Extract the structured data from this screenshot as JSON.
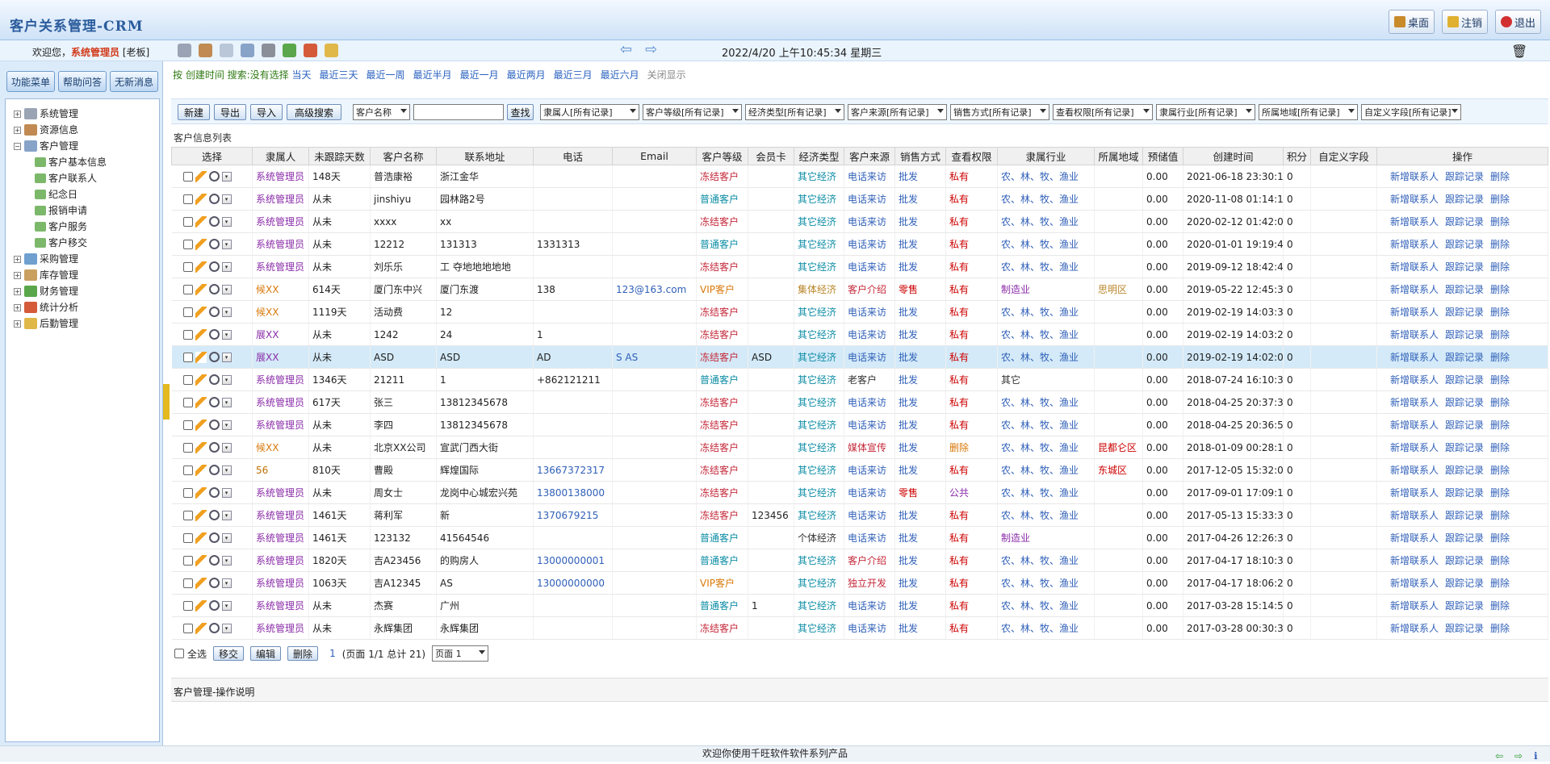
{
  "app": {
    "title": "客户关系管理-CRM"
  },
  "topbar": {
    "desktop": "桌面",
    "logout": "注销",
    "exit": "退出"
  },
  "welcome": {
    "prefix": "欢迎您，",
    "user": "系统管理员",
    "suffix": "[老板]",
    "datetime": "2022/4/20 上午10:45:34 星期三"
  },
  "sidebar": {
    "buttons": [
      "功能菜单",
      "帮助问答",
      "无新消息"
    ],
    "tree": [
      {
        "label": "系统管理",
        "expanded": false
      },
      {
        "label": "资源信息",
        "expanded": false
      },
      {
        "label": "客户管理",
        "expanded": true,
        "children": [
          "客户基本信息",
          "客户联系人",
          "纪念日",
          "报销申请",
          "客户服务",
          "客户移交"
        ]
      },
      {
        "label": "采购管理",
        "expanded": false
      },
      {
        "label": "库存管理",
        "expanded": false
      },
      {
        "label": "财务管理",
        "expanded": false
      },
      {
        "label": "统计分析",
        "expanded": false
      },
      {
        "label": "后勤管理",
        "expanded": false
      }
    ]
  },
  "filter": {
    "lead": "按 创建时间 搜索:没有选择",
    "links": [
      "当天",
      "最近三天",
      "最近一周",
      "最近半月",
      "最近一月",
      "最近两月",
      "最近三月",
      "最近六月"
    ],
    "close": "关闭显示"
  },
  "actions": {
    "new": "新建",
    "export": "导出",
    "import": "导入",
    "advanced": "高级搜索",
    "search": "查找",
    "field_select": "客户名称",
    "filters": [
      "隶属人[所有记录]",
      "客户等级[所有记录]",
      "经济类型[所有记录]",
      "客户来源[所有记录]",
      "销售方式[所有记录]",
      "查看权限[所有记录]",
      "隶属行业[所有记录]",
      "所属地域[所有记录]",
      "自定义字段[所有记录]"
    ]
  },
  "list": {
    "title": "客户信息列表",
    "columns": [
      "选择",
      "隶属人",
      "未跟踪天数",
      "客户名称",
      "联系地址",
      "电话",
      "Email",
      "客户等级",
      "会员卡",
      "经济类型",
      "客户来源",
      "销售方式",
      "查看权限",
      "隶属行业",
      "所属地域",
      "预储值",
      "创建时间",
      "积分",
      "自定义字段",
      "操作"
    ],
    "row_actions": [
      "新增联系人",
      "跟踪记录",
      "删除"
    ],
    "rows": [
      {
        "owner": "系统管理员",
        "ownerColor": "purple",
        "days": "148天",
        "name": "普浩康裕",
        "addr": "浙江金华",
        "phone": "",
        "email": "",
        "level": "冻结客户",
        "card": "",
        "econ": "其它经济",
        "source": "电话来访",
        "sale": "批发",
        "perm": "私有",
        "ind": "农、林、牧、渔业",
        "region": "",
        "pre": "0.00",
        "created": "2021-06-18 23:30:13",
        "pts": "0",
        "custom": ""
      },
      {
        "owner": "系统管理员",
        "ownerColor": "purple",
        "days": "从未",
        "name": "jinshiyu",
        "addr": "园林路2号",
        "phone": "",
        "email": "",
        "level": "普通客户",
        "card": "",
        "econ": "其它经济",
        "source": "电话来访",
        "sale": "批发",
        "perm": "私有",
        "ind": "农、林、牧、渔业",
        "region": "",
        "pre": "0.00",
        "created": "2020-11-08 01:14:11",
        "pts": "0",
        "custom": ""
      },
      {
        "owner": "系统管理员",
        "ownerColor": "purple",
        "days": "从未",
        "name": "xxxx",
        "addr": "xx",
        "phone": "",
        "email": "",
        "level": "冻结客户",
        "card": "",
        "econ": "其它经济",
        "source": "电话来访",
        "sale": "批发",
        "perm": "私有",
        "ind": "农、林、牧、渔业",
        "region": "",
        "pre": "0.00",
        "created": "2020-02-12 01:42:06",
        "pts": "0",
        "custom": ""
      },
      {
        "owner": "系统管理员",
        "ownerColor": "purple",
        "days": "从未",
        "name": "12212",
        "addr": "131313",
        "phone": "1331313",
        "email": "",
        "level": "普通客户",
        "card": "",
        "econ": "其它经济",
        "source": "电话来访",
        "sale": "批发",
        "perm": "私有",
        "ind": "农、林、牧、渔业",
        "region": "",
        "pre": "0.00",
        "created": "2020-01-01 19:19:40",
        "pts": "0",
        "custom": ""
      },
      {
        "owner": "系统管理员",
        "ownerColor": "purple",
        "days": "从未",
        "name": "刘乐乐",
        "addr": "工 夺地地地地地",
        "phone": "",
        "email": "",
        "level": "冻结客户",
        "card": "",
        "econ": "其它经济",
        "source": "电话来访",
        "sale": "批发",
        "perm": "私有",
        "ind": "农、林、牧、渔业",
        "region": "",
        "pre": "0.00",
        "created": "2019-09-12 18:42:44",
        "pts": "0",
        "custom": ""
      },
      {
        "owner": "候XX",
        "ownerColor": "orange",
        "days": "614天",
        "name": "厦门东中兴",
        "addr": "厦门东渡",
        "phone": "138",
        "email": "123@163.com",
        "level": "VIP客户",
        "card": "",
        "econ": "集体经济",
        "source": "客户介绍",
        "sale": "零售",
        "perm": "私有",
        "ind": "制造业",
        "region": "思明区",
        "pre": "0.00",
        "created": "2019-05-22 12:45:33",
        "pts": "0",
        "custom": ""
      },
      {
        "owner": "候XX",
        "ownerColor": "orange",
        "days": "1119天",
        "name": "活动费",
        "addr": "12",
        "phone": "",
        "email": "",
        "level": "冻结客户",
        "card": "",
        "econ": "其它经济",
        "source": "电话来访",
        "sale": "批发",
        "perm": "私有",
        "ind": "农、林、牧、渔业",
        "region": "",
        "pre": "0.00",
        "created": "2019-02-19 14:03:33",
        "pts": "0",
        "custom": ""
      },
      {
        "owner": "展XX",
        "ownerColor": "purple",
        "days": "从未",
        "name": "1242",
        "addr": "24",
        "phone": "1",
        "email": "",
        "level": "冻结客户",
        "card": "",
        "econ": "其它经济",
        "source": "电话来访",
        "sale": "批发",
        "perm": "私有",
        "ind": "农、林、牧、渔业",
        "region": "",
        "pre": "0.00",
        "created": "2019-02-19 14:03:25",
        "pts": "0",
        "custom": ""
      },
      {
        "owner": "展XX",
        "ownerColor": "purple",
        "days": "从未",
        "name": "ASD",
        "addr": "ASD",
        "phone": "AD",
        "email": "S AS",
        "level": "冻结客户",
        "card": "ASD",
        "econ": "其它经济",
        "source": "电话来访",
        "sale": "批发",
        "perm": "私有",
        "ind": "农、林、牧、渔业",
        "region": "",
        "pre": "0.00",
        "created": "2019-02-19 14:02:05",
        "pts": "0",
        "custom": "",
        "highlight": true
      },
      {
        "owner": "系统管理员",
        "ownerColor": "purple",
        "days": "1346天",
        "name": "21211",
        "addr": "1",
        "phone": "+862121211",
        "email": "",
        "level": "普通客户",
        "card": "",
        "econ": "其它经济",
        "source": "老客户",
        "sale": "批发",
        "perm": "私有",
        "ind": "其它",
        "region": "",
        "pre": "0.00",
        "created": "2018-07-24 16:10:38",
        "pts": "0",
        "custom": ""
      },
      {
        "owner": "系统管理员",
        "ownerColor": "purple",
        "days": "617天",
        "name": "张三",
        "addr": "13812345678",
        "phone": "",
        "email": "",
        "level": "冻结客户",
        "card": "",
        "econ": "其它经济",
        "source": "电话来访",
        "sale": "批发",
        "perm": "私有",
        "ind": "农、林、牧、渔业",
        "region": "",
        "pre": "0.00",
        "created": "2018-04-25 20:37:37",
        "pts": "0",
        "custom": ""
      },
      {
        "owner": "系统管理员",
        "ownerColor": "purple",
        "days": "从未",
        "name": "李四",
        "addr": "13812345678",
        "phone": "",
        "email": "",
        "level": "冻结客户",
        "card": "",
        "econ": "其它经济",
        "source": "电话来访",
        "sale": "批发",
        "perm": "私有",
        "ind": "农、林、牧、渔业",
        "region": "",
        "pre": "0.00",
        "created": "2018-04-25 20:36:58",
        "pts": "0",
        "custom": ""
      },
      {
        "owner": "候XX",
        "ownerColor": "orange",
        "days": "从未",
        "name": "北京XX公司",
        "addr": "宣武门西大街",
        "phone": "",
        "email": "",
        "level": "冻结客户",
        "card": "",
        "econ": "其它经济",
        "source": "媒体宣传",
        "sale": "批发",
        "perm": "删除",
        "ind": "农、林、牧、渔业",
        "region": "昆都仑区",
        "pre": "0.00",
        "created": "2018-01-09 00:28:11",
        "pts": "0",
        "custom": ""
      },
      {
        "owner": "56",
        "ownerColor": "gold",
        "days": "810天",
        "name": "曹殿",
        "addr": "辉煌国际",
        "phone": "13667372317",
        "email": "",
        "level": "冻结客户",
        "card": "",
        "econ": "其它经济",
        "source": "电话来访",
        "sale": "批发",
        "perm": "私有",
        "ind": "农、林、牧、渔业",
        "region": "东城区",
        "pre": "0.00",
        "created": "2017-12-05 15:32:04",
        "pts": "0",
        "custom": ""
      },
      {
        "owner": "系统管理员",
        "ownerColor": "purple",
        "days": "从未",
        "name": "周女士",
        "addr": "龙岗中心城宏兴苑",
        "phone": "13800138000",
        "email": "",
        "level": "冻结客户",
        "card": "",
        "econ": "其它经济",
        "source": "电话来访",
        "sale": "零售",
        "perm": "公共",
        "ind": "农、林、牧、渔业",
        "region": "",
        "pre": "0.00",
        "created": "2017-09-01 17:09:10",
        "pts": "0",
        "custom": ""
      },
      {
        "owner": "系统管理员",
        "ownerColor": "purple",
        "days": "1461天",
        "name": "蒋利军",
        "addr": "新",
        "phone": "1370679215",
        "email": "",
        "level": "冻结客户",
        "card": "123456",
        "econ": "其它经济",
        "source": "电话来访",
        "sale": "批发",
        "perm": "私有",
        "ind": "农、林、牧、渔业",
        "region": "",
        "pre": "0.00",
        "created": "2017-05-13 15:33:32",
        "pts": "0",
        "custom": ""
      },
      {
        "owner": "系统管理员",
        "ownerColor": "purple",
        "days": "1461天",
        "name": "123132",
        "addr": "41564546",
        "phone": "",
        "email": "",
        "level": "普通客户",
        "card": "",
        "econ": "个体经济",
        "source": "电话来访",
        "sale": "批发",
        "perm": "私有",
        "ind": "制造业",
        "region": "",
        "pre": "0.00",
        "created": "2017-04-26 12:26:36",
        "pts": "0",
        "custom": ""
      },
      {
        "owner": "系统管理员",
        "ownerColor": "purple",
        "days": "1820天",
        "name": "吉A23456",
        "addr": "的购房人",
        "phone": "13000000001",
        "email": "",
        "level": "普通客户",
        "card": "",
        "econ": "其它经济",
        "source": "客户介绍",
        "sale": "批发",
        "perm": "私有",
        "ind": "农、林、牧、渔业",
        "region": "",
        "pre": "0.00",
        "created": "2017-04-17 18:10:39",
        "pts": "0",
        "custom": ""
      },
      {
        "owner": "系统管理员",
        "ownerColor": "purple",
        "days": "1063天",
        "name": "吉A12345",
        "addr": "AS",
        "phone": "13000000000",
        "email": "",
        "level": "VIP客户",
        "card": "",
        "econ": "其它经济",
        "source": "独立开发",
        "sale": "批发",
        "perm": "私有",
        "ind": "农、林、牧、渔业",
        "region": "",
        "pre": "0.00",
        "created": "2017-04-17 18:06:25",
        "pts": "0",
        "custom": ""
      },
      {
        "owner": "系统管理员",
        "ownerColor": "purple",
        "days": "从未",
        "name": "杰赛",
        "addr": "广州",
        "phone": "",
        "email": "",
        "level": "普通客户",
        "card": "1",
        "econ": "其它经济",
        "source": "电话来访",
        "sale": "批发",
        "perm": "私有",
        "ind": "农、林、牧、渔业",
        "region": "",
        "pre": "0.00",
        "created": "2017-03-28 15:14:53",
        "pts": "0",
        "custom": ""
      },
      {
        "owner": "系统管理员",
        "ownerColor": "purple",
        "days": "从未",
        "name": "永辉集团",
        "addr": "永辉集团",
        "phone": "",
        "email": "",
        "level": "冻结客户",
        "card": "",
        "econ": "其它经济",
        "source": "电话来访",
        "sale": "批发",
        "perm": "私有",
        "ind": "农、林、牧、渔业",
        "region": "",
        "pre": "0.00",
        "created": "2017-03-28 00:30:30",
        "pts": "0",
        "custom": ""
      }
    ]
  },
  "pager": {
    "select_all": "全选",
    "transfer": "移交",
    "edit": "编辑",
    "delete": "删除",
    "page": "1",
    "info": "(页面 1/1  总计 21)",
    "page_select": "页面 1"
  },
  "op_note": "客户管理-操作说明",
  "status": "欢迎你使用千旺软件软件系列产品"
}
